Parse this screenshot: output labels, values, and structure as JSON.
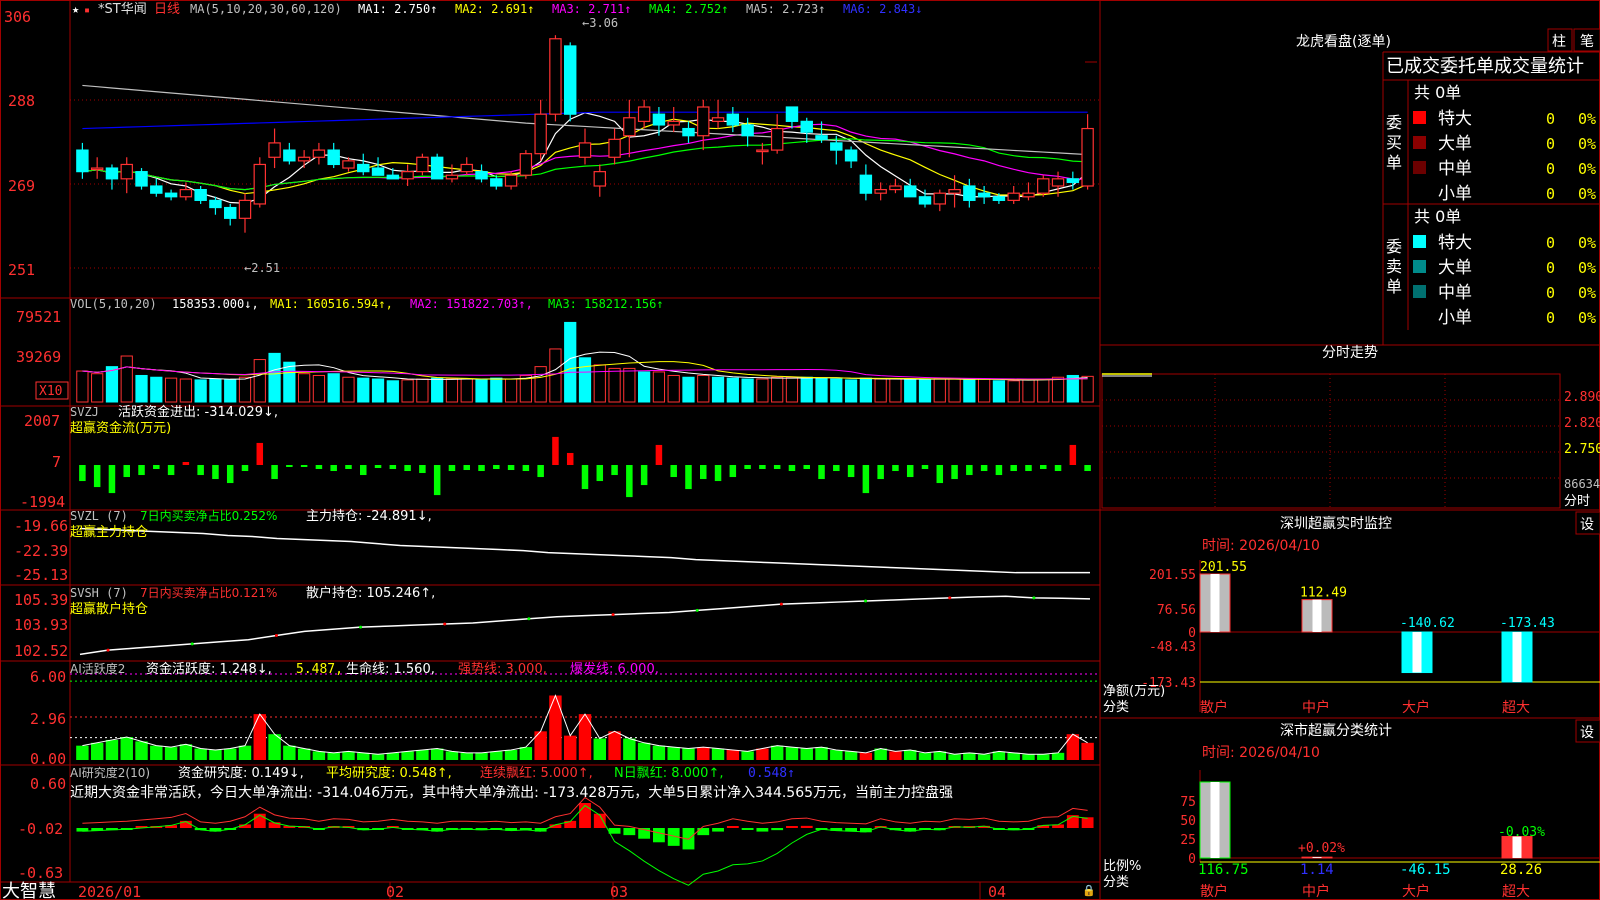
{
  "colors": {
    "up": "#ff3232",
    "down": "#00ffff",
    "bg": "#000000",
    "grid": "#a00000",
    "ma1": "#ffffff",
    "ma2": "#ffff00",
    "ma3": "#ff00ff",
    "ma4": "#00ff00",
    "ma5": "#c0c0c0",
    "ma6": "#0000ff",
    "green": "#00ff00",
    "red": "#ff0000"
  },
  "main": {
    "top_value": "306",
    "stock_name": "*ST华闻",
    "period": "日线",
    "ma_params": "MA(5,10,20,30,60,120)",
    "ma": [
      {
        "label": "MA1: 2.750↑"
      },
      {
        "label": "MA2: 2.691↑"
      },
      {
        "label": "MA3: 2.711↑"
      },
      {
        "label": "MA4: 2.752↑"
      },
      {
        "label": "MA5: 2.723↑"
      },
      {
        "label": "MA6: 2.843↓"
      }
    ],
    "high_note": "3.06",
    "low_note": "←2.51",
    "y_ticks": [
      "288",
      "269",
      "251"
    ],
    "ylim": [
      2.42,
      3.08
    ]
  },
  "vol": {
    "title": "VOL(5,10,20)",
    "value": "158353.000↓,",
    "ma1": "MA1: 160516.594↑,",
    "ma2": "MA2: 151822.703↑,",
    "ma3": "MA3: 158212.156↑",
    "y_ticks": [
      "79521",
      "39269"
    ],
    "unit": "X10"
  },
  "svzj": {
    "title": "SVZJ",
    "desc": "活跃资金进出: -314.029↓,",
    "sub": "超赢资金流(万元)",
    "y_ticks": [
      "2007",
      "7",
      "-1994"
    ]
  },
  "svzl": {
    "title": "SVZL  (7)",
    "desc": "7日内买卖净占比0.252%",
    "hold": "主力持仓: -24.891↓,",
    "sub": "超赢主力持仓",
    "y_ticks": [
      "-19.66",
      "-22.39",
      "-25.13"
    ]
  },
  "svsh": {
    "title": "SVSH  (7)",
    "desc": "7日内买卖净占比0.121%",
    "hold": "散户持仓: 105.246↑,",
    "sub": "超赢散户持仓",
    "y_ticks": [
      "105.39",
      "103.93",
      "102.52"
    ]
  },
  "ai1": {
    "title": "AI活跃度2",
    "a": "资金活跃度: 1.248↓,",
    "b": "5.487,",
    "c": "生命线: 1.560,",
    "d": "强势线: 3.000,",
    "e": "爆发线: 6.000,",
    "y_ticks": [
      "6.00",
      "2.96",
      "0.00"
    ]
  },
  "ai2": {
    "title": "AI研究度2(10)",
    "a": "资金研究度: 0.149↓,",
    "b": "平均研究度: 0.548↑,",
    "c": "连续飘红: 5.000↑,",
    "d": "N日飘红: 8.000↑,",
    "e": "0.548↑",
    "summary": "近期大资金非常活跃，今日大单净流出: -314.046万元，其中特大单净流出: -173.428万元，大单5日累计净入344.565万元，当前主力控盘强",
    "y_ticks": [
      "0.60",
      "-0.02",
      "-0.63"
    ]
  },
  "xaxis": {
    "brand": "大智慧",
    "labels": [
      "2026/01",
      "02",
      "03",
      "04"
    ]
  },
  "right": {
    "lhkp": {
      "title": "龙虎看盘(逐单)",
      "btn1": "柱",
      "btn2": "笔",
      "header": "已成交委托单成交量统计",
      "buy": {
        "label": "委买单",
        "count": "共 0单",
        "rows": [
          {
            "name": "特大",
            "v": "0",
            "p": "0%"
          },
          {
            "name": "大单",
            "v": "0",
            "p": "0%"
          },
          {
            "name": "中单",
            "v": "0",
            "p": "0%"
          },
          {
            "name": "小单",
            "v": "0",
            "p": "0%"
          }
        ]
      },
      "sell": {
        "label": "委卖单",
        "count": "共 0单",
        "rows": [
          {
            "name": "特大",
            "v": "0",
            "p": "0%"
          },
          {
            "name": "大单",
            "v": "0",
            "p": "0%"
          },
          {
            "name": "中单",
            "v": "0",
            "p": "0%"
          },
          {
            "name": "小单",
            "v": "0",
            "p": "0%"
          }
        ]
      }
    },
    "fenshi": {
      "title": "分时走势",
      "y_ticks": [
        "2.890",
        "2.820",
        "2.750"
      ],
      "vol": "86634",
      "footer": "分时"
    },
    "sz_monitor": {
      "title": "深圳超赢实时监控",
      "btn": "设",
      "time": "时间: 2026/04/10",
      "ylabel": "净额(万元)",
      "xlabel": "分类",
      "y_ticks": [
        "201.55",
        "76.56",
        "0",
        "-48.43",
        "-173.43"
      ],
      "cats": [
        "散户",
        "中户",
        "大户",
        "超大"
      ],
      "values": [
        201.55,
        112.49,
        -140.62,
        -173.43
      ],
      "value_labels": [
        "201.55",
        "112.49",
        "-140.62",
        "-173.43"
      ]
    },
    "sz_stat": {
      "title": "深市超赢分类统计",
      "btn": "设",
      "time": "时间: 2026/04/10",
      "ylabel": "比例%",
      "xlabel": "分类",
      "y_ticks": [
        "75",
        "50",
        "25",
        "0"
      ],
      "cats": [
        "散户",
        "中户",
        "大户",
        "超大"
      ],
      "values": [
        116.75,
        1.14,
        -46.15,
        28.26
      ],
      "value_labels": [
        "116.75",
        "1.14",
        "-46.15",
        "28.26"
      ],
      "pct_labels": [
        "",
        "+0.02%",
        "",
        "-0.03%"
      ]
    }
  },
  "chart_data": [
    {
      "type": "candlestick",
      "title": "*ST华闻 日线",
      "ylim": [
        2.42,
        3.08
      ],
      "ohlc": [
        [
          2.74,
          2.76,
          2.66,
          2.68
        ],
        [
          2.69,
          2.72,
          2.66,
          2.69
        ],
        [
          2.69,
          2.7,
          2.63,
          2.66
        ],
        [
          2.66,
          2.72,
          2.62,
          2.7
        ],
        [
          2.68,
          2.69,
          2.63,
          2.64
        ],
        [
          2.64,
          2.66,
          2.61,
          2.62
        ],
        [
          2.62,
          2.63,
          2.6,
          2.61
        ],
        [
          2.61,
          2.65,
          2.6,
          2.63
        ],
        [
          2.63,
          2.64,
          2.59,
          2.6
        ],
        [
          2.6,
          2.61,
          2.56,
          2.58
        ],
        [
          2.58,
          2.59,
          2.53,
          2.55
        ],
        [
          2.55,
          2.62,
          2.51,
          2.6
        ],
        [
          2.59,
          2.72,
          2.58,
          2.7
        ],
        [
          2.72,
          2.8,
          2.69,
          2.76
        ],
        [
          2.74,
          2.76,
          2.7,
          2.71
        ],
        [
          2.71,
          2.74,
          2.69,
          2.72
        ],
        [
          2.72,
          2.76,
          2.7,
          2.74
        ],
        [
          2.74,
          2.76,
          2.69,
          2.7
        ],
        [
          2.69,
          2.72,
          2.68,
          2.71
        ],
        [
          2.7,
          2.73,
          2.67,
          2.68
        ],
        [
          2.69,
          2.72,
          2.67,
          2.67
        ],
        [
          2.67,
          2.69,
          2.66,
          2.66
        ],
        [
          2.66,
          2.7,
          2.64,
          2.68
        ],
        [
          2.68,
          2.73,
          2.67,
          2.72
        ],
        [
          2.72,
          2.73,
          2.66,
          2.66
        ],
        [
          2.66,
          2.7,
          2.65,
          2.67
        ],
        [
          2.68,
          2.72,
          2.67,
          2.7
        ],
        [
          2.68,
          2.7,
          2.65,
          2.66
        ],
        [
          2.66,
          2.67,
          2.63,
          2.64
        ],
        [
          2.64,
          2.68,
          2.63,
          2.67
        ],
        [
          2.67,
          2.74,
          2.66,
          2.73
        ],
        [
          2.73,
          2.88,
          2.71,
          2.84
        ],
        [
          2.84,
          3.06,
          2.82,
          3.05
        ],
        [
          3.03,
          3.04,
          2.82,
          2.84
        ],
        [
          2.72,
          2.8,
          2.7,
          2.76
        ],
        [
          2.64,
          2.7,
          2.61,
          2.68
        ],
        [
          2.72,
          2.8,
          2.7,
          2.77
        ],
        [
          2.78,
          2.88,
          2.72,
          2.83
        ],
        [
          2.82,
          2.88,
          2.8,
          2.86
        ],
        [
          2.84,
          2.86,
          2.78,
          2.81
        ],
        [
          2.81,
          2.86,
          2.79,
          2.82
        ],
        [
          2.8,
          2.82,
          2.76,
          2.78
        ],
        [
          2.78,
          2.88,
          2.74,
          2.86
        ],
        [
          2.82,
          2.88,
          2.8,
          2.83
        ],
        [
          2.84,
          2.86,
          2.79,
          2.81
        ],
        [
          2.81,
          2.83,
          2.75,
          2.78
        ],
        [
          2.74,
          2.76,
          2.7,
          2.74
        ],
        [
          2.74,
          2.84,
          2.73,
          2.8
        ],
        [
          2.86,
          2.86,
          2.8,
          2.82
        ],
        [
          2.82,
          2.83,
          2.76,
          2.79
        ],
        [
          2.78,
          2.82,
          2.76,
          2.77
        ],
        [
          2.76,
          2.78,
          2.7,
          2.74
        ],
        [
          2.74,
          2.75,
          2.69,
          2.71
        ],
        [
          2.67,
          2.7,
          2.6,
          2.62
        ],
        [
          2.62,
          2.65,
          2.6,
          2.63
        ],
        [
          2.63,
          2.66,
          2.62,
          2.64
        ],
        [
          2.64,
          2.66,
          2.61,
          2.61
        ],
        [
          2.61,
          2.63,
          2.58,
          2.59
        ],
        [
          2.59,
          2.63,
          2.57,
          2.62
        ],
        [
          2.62,
          2.67,
          2.58,
          2.63
        ],
        [
          2.64,
          2.66,
          2.58,
          2.6
        ],
        [
          2.62,
          2.64,
          2.59,
          2.61
        ],
        [
          2.61,
          2.62,
          2.59,
          2.6
        ],
        [
          2.6,
          2.64,
          2.59,
          2.62
        ],
        [
          2.61,
          2.65,
          2.6,
          2.62
        ],
        [
          2.62,
          2.67,
          2.61,
          2.66
        ],
        [
          2.64,
          2.68,
          2.61,
          2.66
        ],
        [
          2.66,
          2.68,
          2.63,
          2.65
        ],
        [
          2.64,
          2.84,
          2.63,
          2.8
        ]
      ]
    },
    {
      "type": "bar",
      "title": "VOL(5,10,20)",
      "values": [
        35000,
        32000,
        40000,
        52000,
        30000,
        28000,
        27000,
        26000,
        25000,
        26000,
        25000,
        28000,
        48000,
        55000,
        45000,
        32000,
        30000,
        32000,
        28000,
        27000,
        26000,
        24000,
        25000,
        26000,
        27000,
        26000,
        26000,
        25000,
        27000,
        26000,
        30000,
        40000,
        60000,
        90000,
        50000,
        42000,
        38000,
        38000,
        34000,
        34000,
        30000,
        28000,
        30000,
        28000,
        27000,
        26000,
        26000,
        28000,
        28000,
        28000,
        27000,
        26000,
        25000,
        27000,
        26000,
        26000,
        25000,
        25000,
        27000,
        26000,
        25000,
        26000,
        24000,
        24000,
        25000,
        26000,
        28000,
        30000,
        29000
      ],
      "down": [
        0,
        0,
        1,
        0,
        1,
        1,
        0,
        0,
        1,
        1,
        1,
        0,
        0,
        1,
        1,
        0,
        0,
        1,
        0,
        1,
        1,
        1,
        0,
        0,
        1,
        0,
        0,
        1,
        1,
        0,
        0,
        0,
        0,
        1,
        1,
        0,
        0,
        0,
        1,
        0,
        0,
        1,
        0,
        1,
        1,
        1,
        0,
        0,
        0,
        1,
        1,
        1,
        1,
        1,
        0,
        0,
        1,
        1,
        0,
        0,
        1,
        0,
        1,
        0,
        0,
        0,
        0,
        1,
        0
      ]
    },
    {
      "type": "bar",
      "title": "SVZJ",
      "ylim": [
        -1994,
        2007
      ],
      "values": [
        -800,
        -1100,
        -1400,
        -600,
        -500,
        -200,
        -500,
        150,
        -500,
        -700,
        -900,
        -300,
        1100,
        -700,
        -100,
        -100,
        -200,
        -300,
        -200,
        -500,
        -150,
        -200,
        -300,
        -400,
        -1500,
        -300,
        -250,
        -300,
        -200,
        -250,
        -300,
        -600,
        1400,
        600,
        -1200,
        -800,
        -500,
        -1600,
        -1000,
        1000,
        -600,
        -1200,
        -700,
        -800,
        -600,
        -200,
        -200,
        -200,
        -300,
        -200,
        -700,
        -300,
        -600,
        -1400,
        -700,
        -300,
        -600,
        -200,
        -900,
        -700,
        -500,
        -300,
        -500,
        -300,
        -300,
        -200,
        -300,
        1000,
        -300
      ]
    },
    {
      "type": "line",
      "title": "SVZL",
      "ylim": [
        -25.13,
        -19.66
      ],
      "values": [
        -20.5,
        -20.6,
        -20.7,
        -20.8,
        -20.9,
        -21.0,
        -21.2,
        -21.3,
        -21.5,
        -21.6,
        -21.7,
        -21.8,
        -22.0,
        -22.2,
        -22.3,
        -22.4,
        -22.5,
        -22.6,
        -22.7,
        -22.9,
        -23.0,
        -23.1,
        -23.2,
        -23.3,
        -23.4,
        -23.6,
        -23.7,
        -23.8,
        -23.9,
        -24.0,
        -24.1,
        -24.2,
        -24.3,
        -24.4,
        -24.5,
        -24.6,
        -24.7,
        -24.8,
        -24.9,
        -24.9,
        -24.9,
        -24.9
      ],
      "markers": [
        {
          "i": 30,
          "v": -23.0,
          "c": "down"
        }
      ]
    },
    {
      "type": "line",
      "title": "SVSH",
      "ylim": [
        102.52,
        105.39
      ],
      "values": [
        102.6,
        102.8,
        102.9,
        103.0,
        103.1,
        103.2,
        103.3,
        103.5,
        103.7,
        103.8,
        103.9,
        103.95,
        104.0,
        104.05,
        104.1,
        104.2,
        104.3,
        104.4,
        104.45,
        104.5,
        104.55,
        104.6,
        104.7,
        104.8,
        104.9,
        105.0,
        105.05,
        105.1,
        105.15,
        105.2,
        105.25,
        105.3,
        105.35,
        105.38,
        105.3,
        105.28,
        105.25
      ]
    },
    {
      "type": "bar",
      "title": "AI活跃度2",
      "ylim": [
        0,
        6
      ],
      "values": [
        1.0,
        1.2,
        1.4,
        1.6,
        1.3,
        1.0,
        0.9,
        1.1,
        0.8,
        0.7,
        0.8,
        1.0,
        3.2,
        1.8,
        1.0,
        0.8,
        0.6,
        0.5,
        0.6,
        0.5,
        0.4,
        0.5,
        0.6,
        0.7,
        0.8,
        0.6,
        0.5,
        0.5,
        0.6,
        0.7,
        0.9,
        2.0,
        4.5,
        1.7,
        3.2,
        1.5,
        2.0,
        1.5,
        1.2,
        1.0,
        0.9,
        0.8,
        0.9,
        0.8,
        0.7,
        0.6,
        0.8,
        1.0,
        0.9,
        0.8,
        0.9,
        0.7,
        0.6,
        0.5,
        0.8,
        0.6,
        0.7,
        0.5,
        0.6,
        0.4,
        0.5,
        0.4,
        0.6,
        0.5,
        0.4,
        0.4,
        0.5,
        1.8,
        1.2
      ],
      "red": [
        0,
        0,
        0,
        0,
        0,
        0,
        0,
        0,
        0,
        0,
        0,
        0,
        1,
        0,
        0,
        0,
        0,
        0,
        0,
        0,
        0,
        0,
        0,
        0,
        0,
        0,
        0,
        0,
        0,
        0,
        0,
        1,
        1,
        1,
        1,
        0,
        1,
        0,
        0,
        0,
        0,
        0,
        1,
        0,
        1,
        0,
        1,
        0,
        0,
        0,
        0,
        0,
        0,
        1,
        0,
        1,
        0,
        0,
        0,
        0,
        0,
        0,
        0,
        0,
        0,
        0,
        0,
        1,
        1
      ]
    },
    {
      "type": "bar",
      "title": "AI研究度2",
      "ylim": [
        -0.63,
        0.6
      ],
      "values": [
        -0.05,
        -0.04,
        -0.03,
        -0.02,
        0.0,
        0.02,
        0.04,
        0.1,
        -0.03,
        -0.05,
        -0.02,
        0.05,
        0.2,
        0.08,
        0.03,
        0.02,
        -0.02,
        0.02,
        0.01,
        -0.03,
        -0.02,
        0.01,
        -0.02,
        -0.03,
        -0.05,
        -0.02,
        -0.02,
        -0.03,
        -0.02,
        -0.04,
        -0.03,
        -0.05,
        0.05,
        0.1,
        0.35,
        0.2,
        -0.08,
        -0.1,
        -0.15,
        -0.2,
        -0.25,
        -0.3,
        -0.1,
        -0.05,
        0.02,
        -0.02,
        -0.05,
        -0.03,
        0.02,
        0.03,
        -0.02,
        -0.04,
        -0.05,
        -0.06,
        0.02,
        -0.03,
        -0.05,
        -0.02,
        -0.03,
        0.02,
        0.01,
        0.03,
        -0.02,
        -0.03,
        -0.02,
        0.04,
        0.05,
        0.18,
        0.15
      ]
    }
  ]
}
